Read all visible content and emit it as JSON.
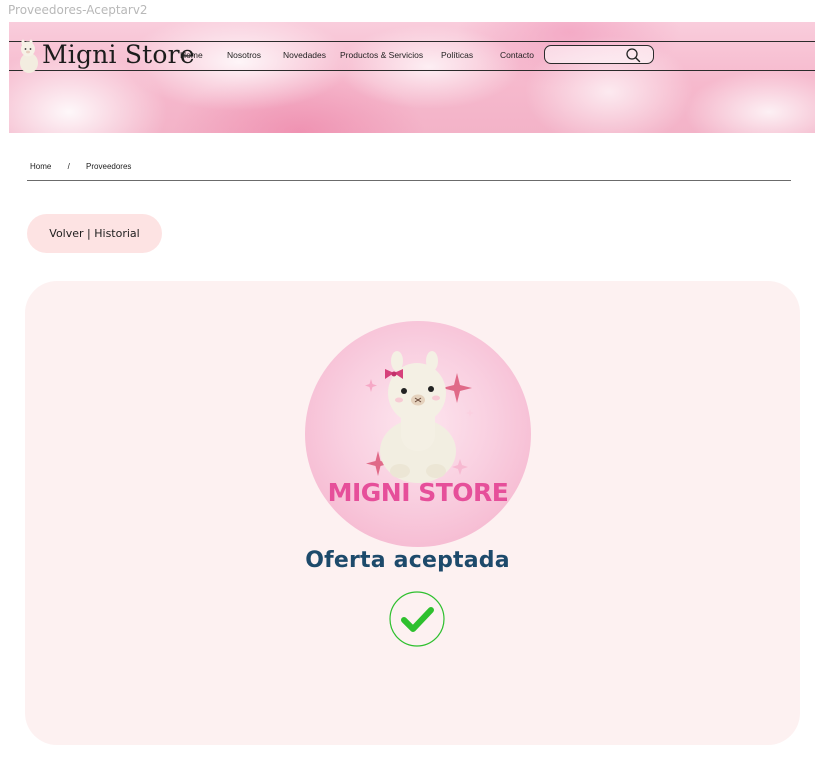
{
  "frame": {
    "label": "Proveedores-Aceptarv2"
  },
  "header": {
    "brand": "Migni Store",
    "nav": [
      "Home",
      "Nosotros",
      "Novedades",
      "Productos & Servicios",
      "Políticas",
      "Contacto"
    ],
    "search": {
      "placeholder": "",
      "icon": "search-icon"
    }
  },
  "breadcrumb": {
    "home": "Home",
    "separator": "/",
    "current": "Proveedores"
  },
  "back_button": {
    "label": "Volver | Historial"
  },
  "result": {
    "logo_text": "MIGNI STORE",
    "title": "Oferta aceptada",
    "status_icon": "check-circle-icon",
    "status_color": "#2ec02e"
  },
  "colors": {
    "title": "#1d4a6b",
    "card_bg": "#fdf1f1",
    "button_bg": "#fde3e3",
    "logo_text": "#e64f9a"
  }
}
